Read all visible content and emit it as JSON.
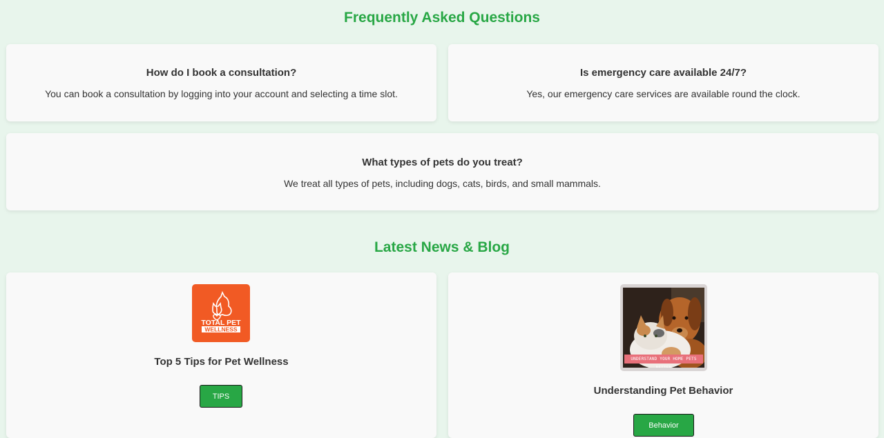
{
  "faq": {
    "title": "Frequently Asked Questions",
    "items": [
      {
        "question": "How do I book a consultation?",
        "answer": "You can book a consultation by logging into your account and selecting a time slot."
      },
      {
        "question": "Is emergency care available 24/7?",
        "answer": "Yes, our emergency care services are available round the clock."
      },
      {
        "question": "What types of pets do you treat?",
        "answer": "We treat all types of pets, including dogs, cats, birds, and small mammals."
      }
    ]
  },
  "blog": {
    "title": "Latest News & Blog",
    "posts": [
      {
        "title": "Top 5 Tips for Pet Wellness",
        "tag": "TIPS",
        "image": {
          "icon": "total-pet-wellness-logo",
          "line1": "TOTAL PET",
          "line2": "WELLNESS",
          "color": "#f15a24"
        }
      },
      {
        "title": "Understanding Pet Behavior",
        "tag": "Behavior",
        "image": {
          "icon": "dog-and-cat-photo",
          "banner": "UNDERSTAND YOUR HOME PETS BETTER"
        }
      }
    ]
  },
  "colors": {
    "accent": "#28a745",
    "background": "#e8f5ec",
    "card": "#f9f9f9"
  }
}
